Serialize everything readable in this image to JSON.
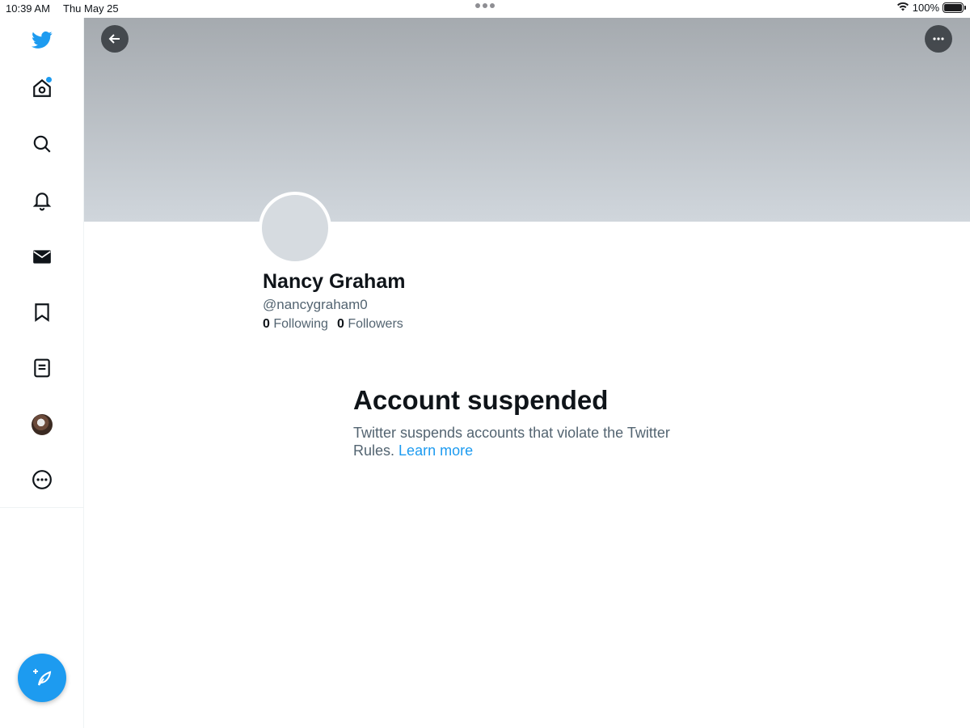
{
  "status_bar": {
    "time": "10:39 AM",
    "date": "Thu May 25",
    "battery": "100%",
    "battery_level": 1.0,
    "icons": [
      "wifi-icon",
      "battery-icon"
    ]
  },
  "sidebar": {
    "items": [
      {
        "name": "twitter-logo-icon"
      },
      {
        "name": "home-icon",
        "has_notification_dot": true
      },
      {
        "name": "search-icon"
      },
      {
        "name": "notifications-bell-icon"
      },
      {
        "name": "messages-envelope-icon"
      },
      {
        "name": "bookmark-icon"
      },
      {
        "name": "lists-icon"
      },
      {
        "name": "profile-avatar"
      },
      {
        "name": "more-circle-icon"
      }
    ],
    "compose_icon": "compose-tweet-icon"
  },
  "header": {
    "back_icon": "back-arrow-icon",
    "more_icon": "more-horizontal-icon"
  },
  "profile": {
    "display_name": "Nancy Graham",
    "handle": "@nancygraham0",
    "following_count": "0",
    "following_label": "Following",
    "followers_count": "0",
    "followers_label": "Followers"
  },
  "suspension": {
    "title": "Account suspended",
    "message": "Twitter suspends accounts that violate the Twitter Rules.",
    "link_text": "Learn more"
  },
  "colors": {
    "accent": "#1d9bf0",
    "text_primary": "#0f1419",
    "text_secondary": "#536471",
    "avatar_placeholder": "#d6dbe0"
  }
}
